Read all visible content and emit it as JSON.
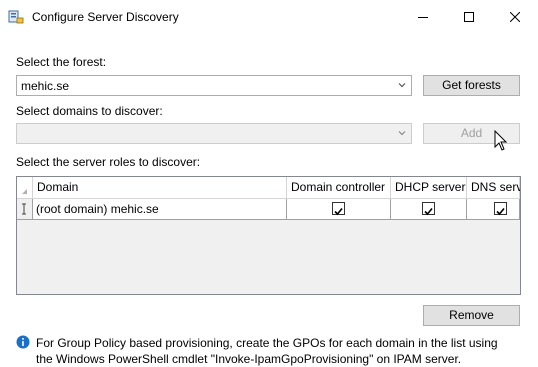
{
  "window": {
    "title": "Configure Server Discovery"
  },
  "forest": {
    "label": "Select the forest:",
    "value": "mehic.se",
    "get_button": "Get forests"
  },
  "domains": {
    "label": "Select domains to discover:",
    "value": "",
    "add_button": "Add"
  },
  "roles": {
    "label": "Select the server roles to discover:",
    "columns": [
      "Domain",
      "Domain controller",
      "DHCP server",
      "DNS server"
    ],
    "rows": [
      {
        "domain": "(root domain) mehic.se",
        "domain_controller": true,
        "dhcp_server": true,
        "dns_server": true
      }
    ]
  },
  "remove_button": "Remove",
  "info": {
    "text": "For Group Policy based provisioning, create the GPOs for each domain in the list using the Windows PowerShell cmdlet \"Invoke-IpamGpoProvisioning\" on IPAM server."
  },
  "colors": {
    "accent": "#1a6fc9",
    "button_bg": "#e1e1e1",
    "border": "#adadad"
  }
}
